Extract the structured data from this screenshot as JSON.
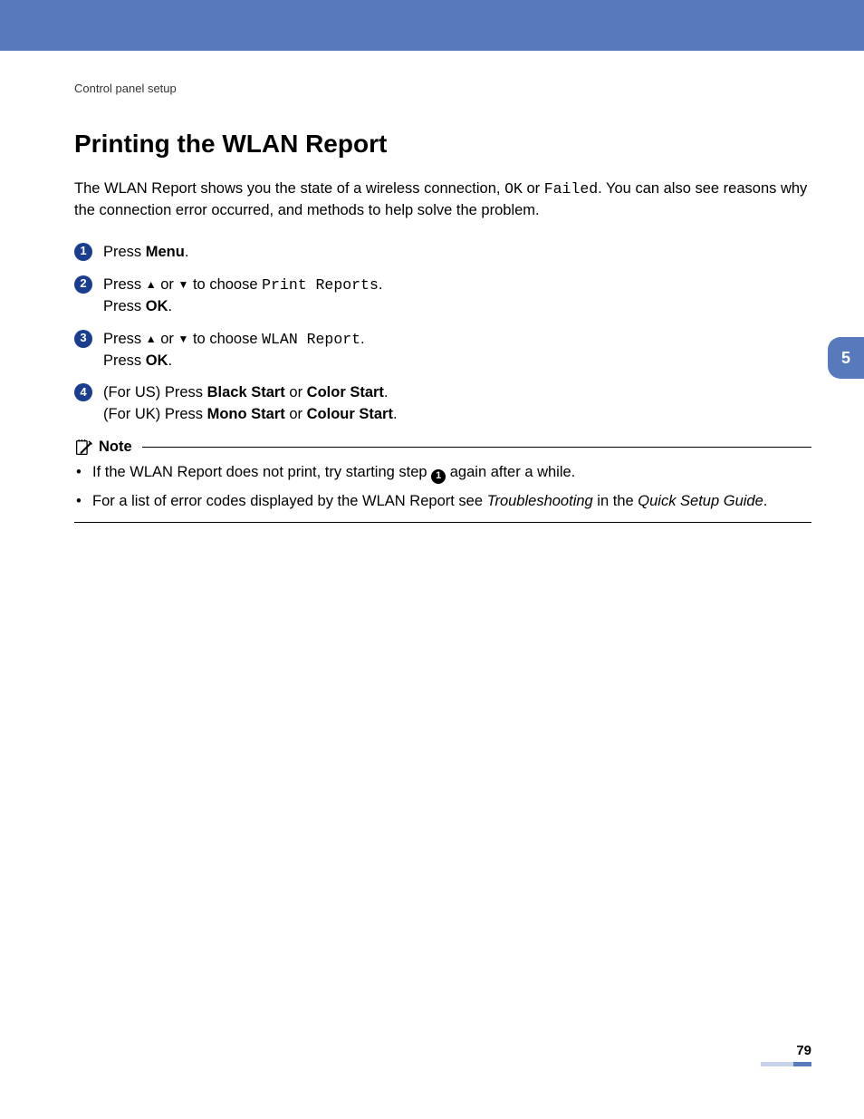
{
  "section": "Control panel setup",
  "title": "Printing the WLAN Report",
  "intro": {
    "p1a": "The WLAN Report shows you the state of a wireless connection, ",
    "ok": "OK",
    "p1b": " or ",
    "failed": "Failed",
    "p1c": ". You can also see reasons why the connection error occurred, and methods to help solve the problem."
  },
  "steps": {
    "n1": "1",
    "n2": "2",
    "n3": "3",
    "n4": "4",
    "s1_a": "Press ",
    "s1_b": "Menu",
    "s1_c": ".",
    "s2_a": "Press ",
    "s2_b": " or ",
    "s2_c": " to choose ",
    "s2_mono": "Print Reports",
    "s2_d": ".",
    "s2_e": "Press ",
    "s2_f": "OK",
    "s2_g": ".",
    "s3_a": "Press ",
    "s3_b": " or ",
    "s3_c": " to choose ",
    "s3_mono": "WLAN Report",
    "s3_d": ".",
    "s3_e": "Press ",
    "s3_f": "OK",
    "s3_g": ".",
    "s4_a": "(For US) Press ",
    "s4_b": "Black Start",
    "s4_c": " or ",
    "s4_d": "Color Start",
    "s4_e": ".",
    "s4_f": "(For UK) Press ",
    "s4_g": "Mono Start",
    "s4_h": " or ",
    "s4_i": "Colour Start",
    "s4_j": "."
  },
  "note": {
    "label": "Note",
    "b1_a": "If the WLAN Report does not print, try starting step ",
    "b1_num": "1",
    "b1_b": " again after a while.",
    "b2_a": "For a list of error codes displayed by the WLAN Report see ",
    "b2_i1": "Troubleshooting",
    "b2_b": " in the ",
    "b2_i2": "Quick Setup Guide",
    "b2_c": "."
  },
  "tab": "5",
  "page": "79",
  "glyph": {
    "up": "▲",
    "down": "▼"
  }
}
